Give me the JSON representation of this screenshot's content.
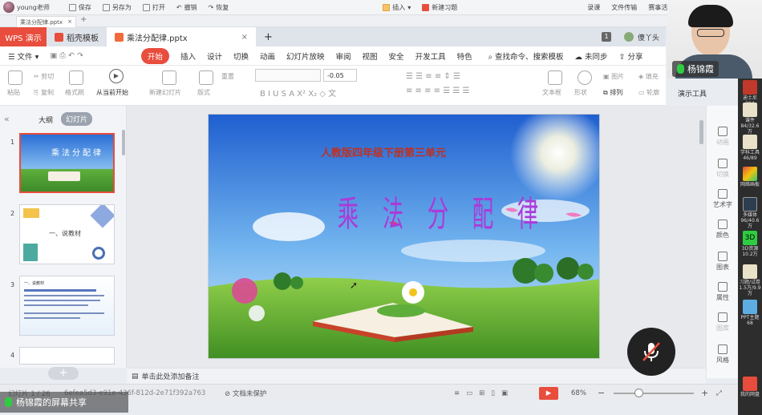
{
  "topbar": {
    "user": "young老师",
    "items": [
      "保存",
      "另存为",
      "打开",
      "撤销",
      "恢复"
    ],
    "mid": [
      "插入",
      "新建习题"
    ],
    "right": [
      "录课",
      "文件传输",
      "赛事活动"
    ]
  },
  "file_tab": {
    "name": "乘法分配律.pptx",
    "close": "×"
  },
  "app_tabs": {
    "wps": "WPS 演示",
    "template": "稻壳模板",
    "doc": "乘法分配律.pptx",
    "add": "+"
  },
  "account": {
    "badge": "1",
    "name": "傻丫头"
  },
  "menu": {
    "file": "文件",
    "tabs": [
      "开始",
      "插入",
      "设计",
      "切换",
      "动画",
      "幻灯片放映",
      "审阅",
      "视图",
      "安全",
      "开发工具",
      "特色"
    ],
    "search": "查找命令、搜索模板",
    "sync": "未同步",
    "share": "分享"
  },
  "ribbon": {
    "paste": "粘贴",
    "cut": "剪切",
    "copy": "复制",
    "format": "格式刷",
    "play": "从当前开始",
    "newslide": "新建幻灯片",
    "layout": "版式",
    "reset": "重置",
    "font_size": "-0.05",
    "text_box": "文本框",
    "shape": "形状",
    "image": "图片",
    "fill": "填充",
    "arrange": "排列",
    "outline": "轮廓",
    "tools": "演示工具"
  },
  "presenter": {
    "name": "杨锦霞"
  },
  "left_panel": {
    "tab_outline": "大纲",
    "tab_slides": "幻灯片",
    "thumb2_title": "一、说教材",
    "thumb3_title": "一、说教材",
    "thumbs": [
      "1",
      "2",
      "3",
      "4"
    ]
  },
  "right_panel": [
    "动画",
    "切换",
    "艺术字",
    "颜色",
    "图表",
    "属性",
    "图库",
    "风格"
  ],
  "strip": [
    {
      "label": "迪士尼",
      "sub": "294"
    },
    {
      "label": "课件",
      "sub": "84/32.6万"
    },
    {
      "label": "学科工具",
      "sub": "46/89"
    },
    {
      "label": "网络画板"
    },
    {
      "label": "多媒体",
      "sub": "96/40.6万"
    },
    {
      "label": "3D资源",
      "sub": "10.2万"
    },
    {
      "label": "习题/试卷",
      "sub": "1.5万/9.9万"
    },
    {
      "label": "PPT主题",
      "sub": "68"
    },
    {
      "label": "我的网盘"
    }
  ],
  "slide": {
    "subtitle": "人教版四年级下册第三单元",
    "title": [
      "乘",
      "法",
      "分",
      "配",
      "律"
    ]
  },
  "notes": {
    "hint": "单击此处添加备注"
  },
  "status": {
    "slide": "幻灯片 1 / 26",
    "id": "6efea5d3-e91e-436f-812d-2e71f392a763",
    "protect": "文档未保护",
    "zoom": "68%"
  },
  "share_label": "杨锦霞的屏幕共享",
  "colors": {
    "accent": "#e84d3d",
    "title_purple": "#a93bd8",
    "subtitle_red": "#c0301f"
  }
}
